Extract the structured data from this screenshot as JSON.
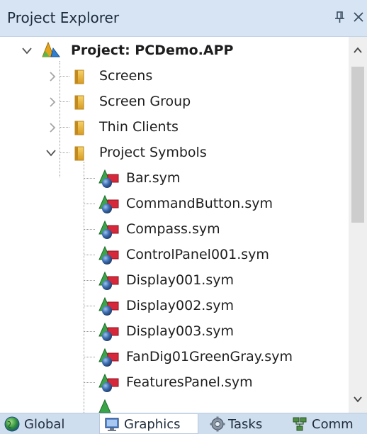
{
  "panel": {
    "title": "Project Explorer"
  },
  "tree": {
    "root_label": "Project: PCDemo.APP",
    "folders": [
      {
        "label": "Screens",
        "state": "collapsed"
      },
      {
        "label": "Screen Group",
        "state": "collapsed"
      },
      {
        "label": "Thin Clients",
        "state": "collapsed"
      },
      {
        "label": "Project Symbols",
        "state": "expanded"
      }
    ],
    "symbols": [
      {
        "label": "Bar.sym"
      },
      {
        "label": "CommandButton.sym"
      },
      {
        "label": "Compass.sym"
      },
      {
        "label": "ControlPanel001.sym"
      },
      {
        "label": "Display001.sym"
      },
      {
        "label": "Display002.sym"
      },
      {
        "label": "Display003.sym"
      },
      {
        "label": "FanDig01GreenGray.sym"
      },
      {
        "label": "FeaturesPanel.sym"
      }
    ]
  },
  "tabs": [
    {
      "label": "Global",
      "icon": "globe-icon",
      "selected": false
    },
    {
      "label": "Graphics",
      "icon": "monitor-icon",
      "selected": true
    },
    {
      "label": "Tasks",
      "icon": "gear-icon",
      "selected": false
    },
    {
      "label": "Comm",
      "icon": "network-icon",
      "selected": false
    }
  ],
  "colors": {
    "titlebar": "#d6e4f3",
    "tabbar": "#cfdeef",
    "folder": "#e8b53e",
    "symbol_red": "#d6283a",
    "symbol_green": "#3aa548",
    "symbol_blue": "#3d6fb3"
  }
}
